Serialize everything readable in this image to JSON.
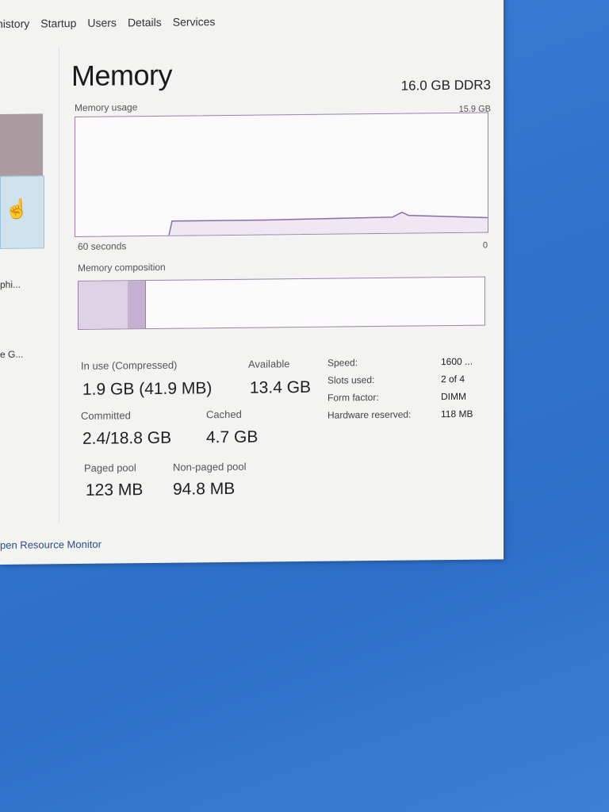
{
  "tabs": [
    "history",
    "Startup",
    "Users",
    "Details",
    "Services"
  ],
  "title": "Memory",
  "spec": "16.0 GB DDR3",
  "graph": {
    "label": "Memory usage",
    "max_label": "15.9 GB",
    "time_label": "60 seconds",
    "min_label": "0"
  },
  "composition_label": "Memory composition",
  "sidebar": {
    "item_1": "phi...",
    "item_2": "e G..."
  },
  "stats": {
    "in_use_label": "In use (Compressed)",
    "in_use_value": "1.9 GB (41.9 MB)",
    "available_label": "Available",
    "available_value": "13.4 GB",
    "committed_label": "Committed",
    "committed_value": "2.4/18.8 GB",
    "cached_label": "Cached",
    "cached_value": "4.7 GB",
    "paged_label": "Paged pool",
    "paged_value": "123 MB",
    "nonpaged_label": "Non-paged pool",
    "nonpaged_value": "94.8 MB"
  },
  "details": {
    "speed_label": "Speed:",
    "speed_value": "1600 ...",
    "slots_label": "Slots used:",
    "slots_value": "2 of 4",
    "form_label": "Form factor:",
    "form_value": "DIMM",
    "hw_label": "Hardware reserved:",
    "hw_value": "118 MB"
  },
  "link": "pen Resource Monitor",
  "colors": {
    "accent": "#9a7fb0",
    "desktop": "#2f73cc"
  }
}
